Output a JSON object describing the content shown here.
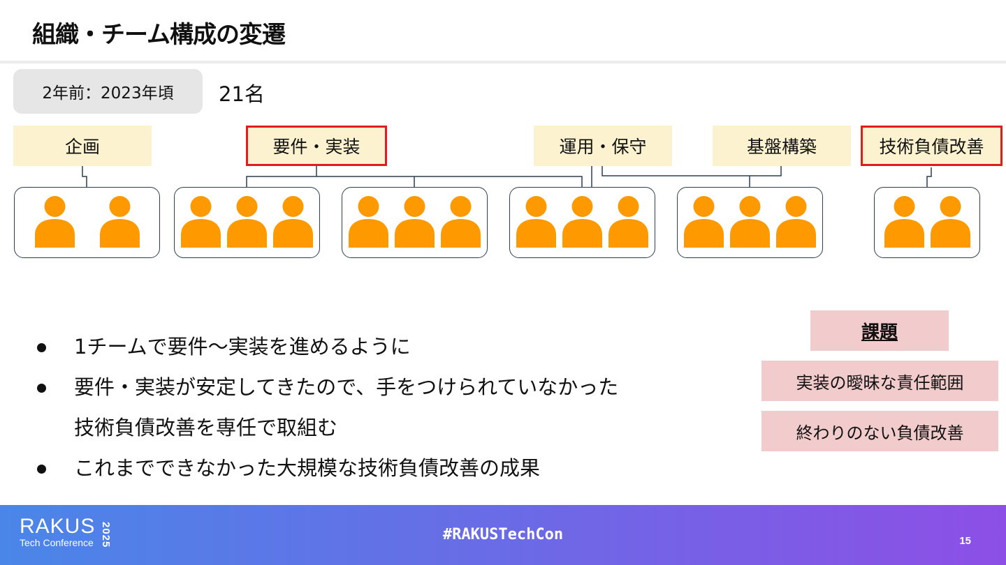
{
  "slide": {
    "title": "組織・チーム構成の変遷",
    "era_label": "2年前：2023年頃",
    "member_count": "21名"
  },
  "roles": [
    {
      "label": "企画",
      "highlighted": false
    },
    {
      "label": "要件・実装",
      "highlighted": true
    },
    {
      "label": "運用・保守",
      "highlighted": false
    },
    {
      "label": "基盤構築",
      "highlighted": false
    },
    {
      "label": "技術負債改善",
      "highlighted": true
    }
  ],
  "teams": [
    {
      "members": 2
    },
    {
      "members": 3
    },
    {
      "members": 3
    },
    {
      "members": 3
    },
    {
      "members": 3
    },
    {
      "members": 2
    }
  ],
  "bullets": [
    {
      "text": "1チームで要件～実装を進めるように"
    },
    {
      "text": "要件・実装が安定してきたので、手をつけられていなかった",
      "continuation": "技術負債改善を専任で取組む"
    },
    {
      "text": "これまでできなかった大規模な技術負債改善の成果"
    }
  ],
  "issues": {
    "heading": "課題",
    "items": [
      "実装の曖昧な責任範囲",
      "終わりのない負債改善"
    ]
  },
  "footer": {
    "brand_name": "RAKUS",
    "brand_sub": "Tech Conference",
    "brand_year": "2025",
    "hashtag": "#RAKUSTechCon",
    "page_number": "15"
  },
  "colors": {
    "role_fill": "#fdf2d0",
    "highlight_border": "#e21b1b",
    "person": "#ff9900",
    "team_border": "#2c3e50",
    "issue_fill": "#f2cccc",
    "footer_gradient_start": "#4a86e8",
    "footer_gradient_end": "#8d4fe6"
  }
}
